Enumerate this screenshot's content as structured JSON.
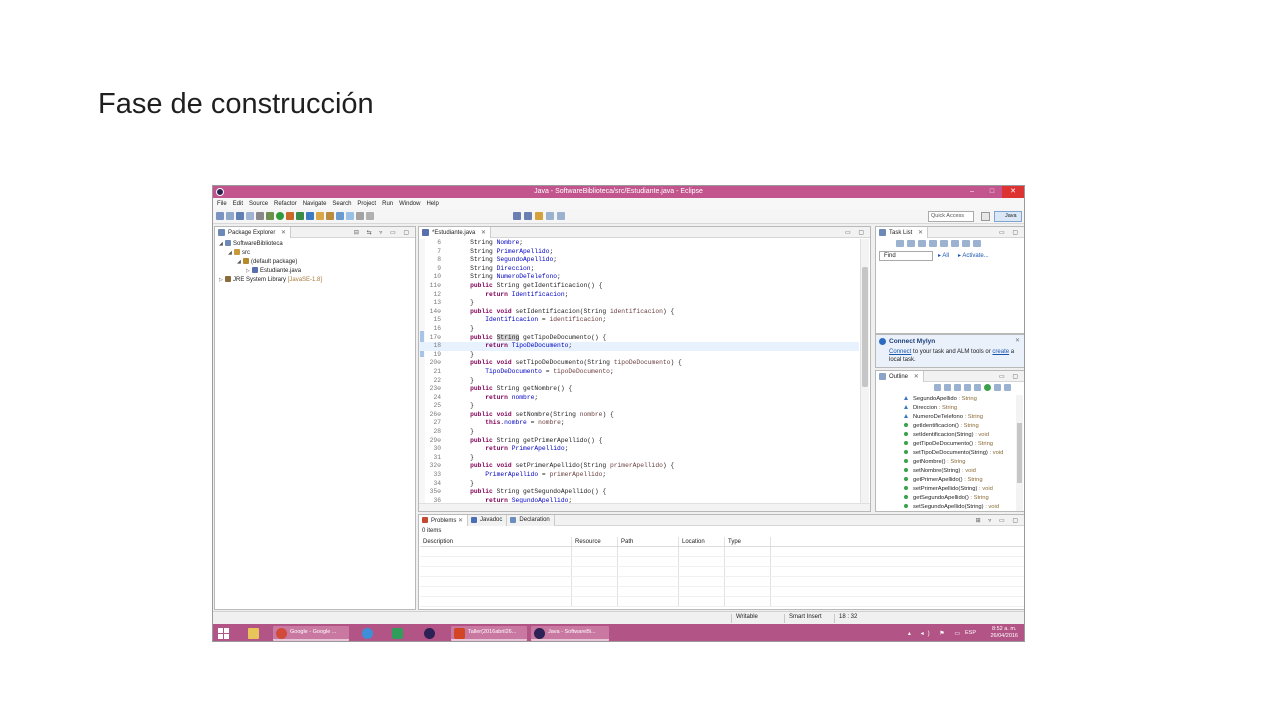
{
  "slide": {
    "title": "Fase de construcción"
  },
  "window": {
    "title": "Java - SoftwareBiblioteca/src/Estudiante.java - Eclipse",
    "controls": {
      "minimize": "–",
      "maximize": "□",
      "close": "✕"
    }
  },
  "menu": [
    "File",
    "Edit",
    "Source",
    "Refactor",
    "Navigate",
    "Search",
    "Project",
    "Run",
    "Window",
    "Help"
  ],
  "toolbar": {
    "quick_access_placeholder": "Quick Access",
    "perspective": "Java"
  },
  "package_explorer": {
    "tab": "Package Explorer",
    "tree": [
      {
        "label": "SoftwareBiblioteca",
        "indent": 0,
        "arrow": "◢",
        "icon_color": "#6d89b5",
        "icon": "project-icon"
      },
      {
        "label": "src",
        "indent": 1,
        "arrow": "◢",
        "icon_color": "#c89a3a",
        "icon": "source-folder-icon"
      },
      {
        "label": "(default package)",
        "indent": 2,
        "arrow": "◢",
        "icon_color": "#b48a2c",
        "icon": "package-icon"
      },
      {
        "label": "Estudiante.java",
        "indent": 3,
        "arrow": "▷",
        "icon_color": "#5a6fb0",
        "icon": "java-file-icon"
      },
      {
        "label": "JRE System Library",
        "suffix": "[JavaSE-1.8]",
        "indent": 0,
        "arrow": "▷",
        "icon_color": "#8a6d3b",
        "icon": "library-icon"
      }
    ]
  },
  "editor": {
    "tab": "*Estudiante.java",
    "lines": [
      {
        "n": "6",
        "code": [
          [
            "    String ",
            ""
          ],
          [
            "Nombre",
            "fld"
          ],
          [
            ";",
            ""
          ]
        ]
      },
      {
        "n": "7",
        "code": [
          [
            "    String ",
            ""
          ],
          [
            "PrimerApellido",
            "fld"
          ],
          [
            ";",
            ""
          ]
        ]
      },
      {
        "n": "8",
        "code": [
          [
            "    String ",
            ""
          ],
          [
            "SegundoApellido",
            "fld"
          ],
          [
            ";",
            ""
          ]
        ]
      },
      {
        "n": "9",
        "code": [
          [
            "    String ",
            ""
          ],
          [
            "Direccion",
            "fld"
          ],
          [
            ";",
            ""
          ]
        ]
      },
      {
        "n": "10",
        "code": [
          [
            "    String ",
            ""
          ],
          [
            "NumeroDeTelefono",
            "fld"
          ],
          [
            ";",
            ""
          ]
        ]
      },
      {
        "n": "11⊖",
        "code": [
          [
            "    ",
            ""
          ],
          [
            "public",
            "kw"
          ],
          [
            " String getIdentificacion() {",
            ""
          ]
        ]
      },
      {
        "n": "12",
        "code": [
          [
            "        ",
            ""
          ],
          [
            "return",
            "kw"
          ],
          [
            " ",
            ""
          ],
          [
            "Identificacion",
            "fld"
          ],
          [
            ";",
            ""
          ]
        ]
      },
      {
        "n": "13",
        "code": [
          [
            "    }",
            ""
          ]
        ]
      },
      {
        "n": "14⊖",
        "code": [
          [
            "    ",
            ""
          ],
          [
            "public",
            "kw"
          ],
          [
            " ",
            ""
          ],
          [
            "void",
            "kw"
          ],
          [
            " setIdentificacion(String ",
            ""
          ],
          [
            "identificacion",
            "prm"
          ],
          [
            ") {",
            ""
          ]
        ]
      },
      {
        "n": "15",
        "code": [
          [
            "        ",
            ""
          ],
          [
            "Identificacion",
            "fld"
          ],
          [
            " = ",
            ""
          ],
          [
            "identificacion",
            "prm"
          ],
          [
            ";",
            ""
          ]
        ]
      },
      {
        "n": "16",
        "code": [
          [
            "    }",
            ""
          ]
        ]
      },
      {
        "n": "17⊖",
        "code": [
          [
            "    ",
            ""
          ],
          [
            "public",
            "kw"
          ],
          [
            " ",
            ""
          ],
          [
            "String",
            "sel"
          ],
          [
            " getTipoDeDocumento() {",
            ""
          ]
        ]
      },
      {
        "n": "18",
        "hl": true,
        "code": [
          [
            "        ",
            ""
          ],
          [
            "return",
            "kw"
          ],
          [
            " ",
            ""
          ],
          [
            "TipoDeDocumento",
            "fld"
          ],
          [
            ";",
            ""
          ]
        ]
      },
      {
        "n": "19",
        "code": [
          [
            "    }",
            ""
          ]
        ]
      },
      {
        "n": "20⊖",
        "code": [
          [
            "    ",
            ""
          ],
          [
            "public",
            "kw"
          ],
          [
            " ",
            ""
          ],
          [
            "void",
            "kw"
          ],
          [
            " setTipoDeDocumento(String ",
            ""
          ],
          [
            "tipoDeDocumento",
            "prm"
          ],
          [
            ") {",
            ""
          ]
        ]
      },
      {
        "n": "21",
        "code": [
          [
            "        ",
            ""
          ],
          [
            "TipoDeDocumento",
            "fld"
          ],
          [
            " = ",
            ""
          ],
          [
            "tipoDeDocumento",
            "prm"
          ],
          [
            ";",
            ""
          ]
        ]
      },
      {
        "n": "22",
        "code": [
          [
            "    }",
            ""
          ]
        ]
      },
      {
        "n": "23⊖",
        "code": [
          [
            "    ",
            ""
          ],
          [
            "public",
            "kw"
          ],
          [
            " String getNombre() {",
            ""
          ]
        ]
      },
      {
        "n": "24",
        "code": [
          [
            "        ",
            ""
          ],
          [
            "return",
            "kw"
          ],
          [
            " ",
            ""
          ],
          [
            "nombre",
            "fld"
          ],
          [
            ";",
            ""
          ]
        ]
      },
      {
        "n": "25",
        "code": [
          [
            "    }",
            ""
          ]
        ]
      },
      {
        "n": "26⊖",
        "code": [
          [
            "    ",
            ""
          ],
          [
            "public",
            "kw"
          ],
          [
            " ",
            ""
          ],
          [
            "void",
            "kw"
          ],
          [
            " setNombre(String ",
            ""
          ],
          [
            "nombre",
            "prm"
          ],
          [
            ") {",
            ""
          ]
        ]
      },
      {
        "n": "27",
        "code": [
          [
            "        ",
            ""
          ],
          [
            "this",
            "kw"
          ],
          [
            ".",
            ""
          ],
          [
            "nombre",
            "fld"
          ],
          [
            " = ",
            ""
          ],
          [
            "nombre",
            "prm"
          ],
          [
            ";",
            ""
          ]
        ]
      },
      {
        "n": "28",
        "code": [
          [
            "    }",
            ""
          ]
        ]
      },
      {
        "n": "29⊖",
        "code": [
          [
            "    ",
            ""
          ],
          [
            "public",
            "kw"
          ],
          [
            " String getPrimerApellido() {",
            ""
          ]
        ]
      },
      {
        "n": "30",
        "code": [
          [
            "        ",
            ""
          ],
          [
            "return",
            "kw"
          ],
          [
            " ",
            ""
          ],
          [
            "PrimerApellido",
            "fld"
          ],
          [
            ";",
            ""
          ]
        ]
      },
      {
        "n": "31",
        "code": [
          [
            "    }",
            ""
          ]
        ]
      },
      {
        "n": "32⊖",
        "code": [
          [
            "    ",
            ""
          ],
          [
            "public",
            "kw"
          ],
          [
            " ",
            ""
          ],
          [
            "void",
            "kw"
          ],
          [
            " setPrimerApellido(String ",
            ""
          ],
          [
            "primerApellido",
            "prm"
          ],
          [
            ") {",
            ""
          ]
        ]
      },
      {
        "n": "33",
        "code": [
          [
            "        ",
            ""
          ],
          [
            "PrimerApellido",
            "fld"
          ],
          [
            " = ",
            ""
          ],
          [
            "primerApellido",
            "prm"
          ],
          [
            ";",
            ""
          ]
        ]
      },
      {
        "n": "34",
        "code": [
          [
            "    }",
            ""
          ]
        ]
      },
      {
        "n": "35⊖",
        "code": [
          [
            "    ",
            ""
          ],
          [
            "public",
            "kw"
          ],
          [
            " String getSegundoApellido() {",
            ""
          ]
        ]
      },
      {
        "n": "36",
        "code": [
          [
            "        ",
            ""
          ],
          [
            "return",
            "kw"
          ],
          [
            " ",
            ""
          ],
          [
            "SegundoApellido",
            "fld"
          ],
          [
            ";",
            ""
          ]
        ]
      }
    ]
  },
  "tasklist": {
    "tab": "Task List",
    "find_placeholder": "Find",
    "all_label": "All",
    "activate_label": "Activate..."
  },
  "mylyn": {
    "title": "Connect Mylyn",
    "link1": "Connect",
    "text1": " to your task and ALM tools or ",
    "link2": "create",
    "text2": " a local task."
  },
  "outline": {
    "tab": "Outline",
    "items": [
      {
        "name": "SegundoApellido",
        "type": " : String",
        "kind": "field"
      },
      {
        "name": "Direccion",
        "type": " : String",
        "kind": "field"
      },
      {
        "name": "NumeroDeTelefono",
        "type": " : String",
        "kind": "field"
      },
      {
        "name": "getIdentificacion()",
        "type": " : String",
        "kind": "method"
      },
      {
        "name": "setIdentificacion(String)",
        "type": " : void",
        "kind": "method"
      },
      {
        "name": "getTipoDeDocumento()",
        "type": " : String",
        "kind": "method"
      },
      {
        "name": "setTipoDeDocumento(String)",
        "type": " : void",
        "kind": "method"
      },
      {
        "name": "getNombre()",
        "type": " : String",
        "kind": "method"
      },
      {
        "name": "setNombre(String)",
        "type": " : void",
        "kind": "method"
      },
      {
        "name": "getPrimerApellido()",
        "type": " : String",
        "kind": "method"
      },
      {
        "name": "setPrimerApellido(String)",
        "type": " : void",
        "kind": "method"
      },
      {
        "name": "getSegundoApellido()",
        "type": " : String",
        "kind": "method"
      },
      {
        "name": "setSegundoApellido(String)",
        "type": " : void",
        "kind": "method"
      }
    ]
  },
  "problems": {
    "tabs": [
      "Problems",
      "Javadoc",
      "Declaration"
    ],
    "count": "0 items",
    "columns": [
      "Description",
      "Resource",
      "Path",
      "Location",
      "Type"
    ]
  },
  "status": {
    "mode": "Writable",
    "insert": "Smart Insert",
    "position": "18 : 32"
  },
  "taskbar": {
    "apps": [
      {
        "label": "Google - Google ...",
        "color": "#d24a3a",
        "icon": "chrome-icon"
      },
      {
        "label": "Taller(2016abril26...",
        "color": "#d24625",
        "icon": "powerpoint-icon"
      },
      {
        "label": "Java - SoftwareBi...",
        "color": "#2c2255",
        "icon": "eclipse-icon"
      }
    ],
    "lang": "ESP",
    "time": "8:52 a. m.",
    "date": "26/04/2016"
  }
}
